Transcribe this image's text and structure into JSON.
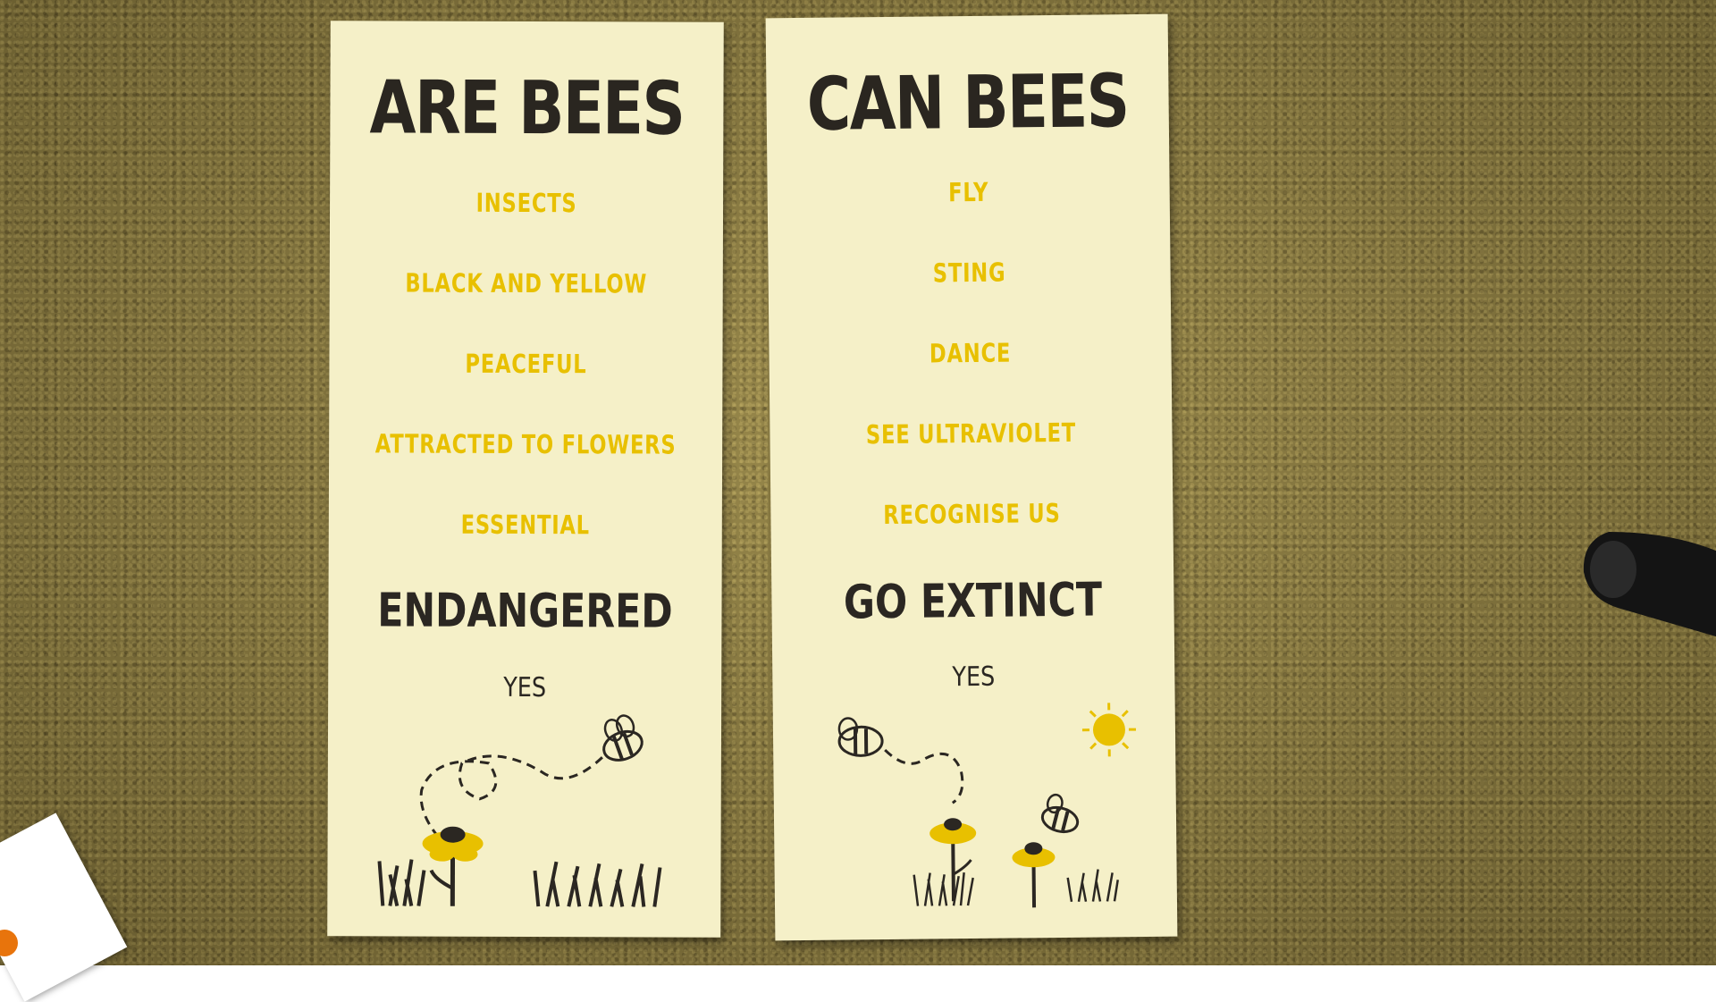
{
  "scene": {
    "carpet_color": "#8a7a3e",
    "card_color": "#f5f0c8",
    "accent_yellow": "#e8c000",
    "text_dark": "#2b2722"
  },
  "left_sign": {
    "title": "ARE BEES",
    "items": [
      "INSECTS",
      "BLACK AND YELLOW",
      "PEACEFUL",
      "ATTRACTED TO FLOWERS",
      "ESSENTIAL"
    ],
    "final": "ENDANGERED",
    "answer": "YES"
  },
  "right_sign": {
    "title": "CAN BEES",
    "items": [
      "FLY",
      "STING",
      "DANCE",
      "SEE ULTRAVIOLET",
      "RECOGNISE US"
    ],
    "final": "GO EXTINCT",
    "answer": "YES"
  },
  "illustrations": {
    "left": [
      "bee-icon",
      "flight-path-icon",
      "sunflower-icon",
      "grass-icon"
    ],
    "right": [
      "bee-icon",
      "flight-path-icon",
      "sunflower-icon",
      "sun-icon",
      "grass-icon"
    ]
  }
}
